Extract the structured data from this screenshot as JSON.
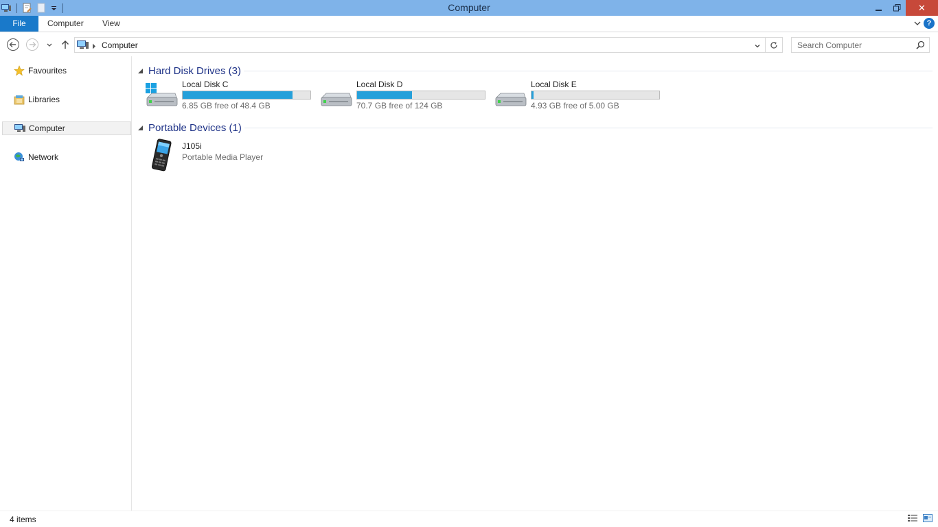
{
  "window": {
    "title": "Computer",
    "controls": {
      "minimize": "─",
      "maximize": "❐",
      "close": "✕"
    }
  },
  "ribbon": {
    "tabs": [
      {
        "label": "File"
      },
      {
        "label": "Computer"
      },
      {
        "label": "View"
      }
    ],
    "help": "?"
  },
  "address": {
    "crumb": "Computer",
    "search_placeholder": "Search Computer"
  },
  "nav": {
    "items": [
      {
        "label": "Favourites",
        "icon": "star-icon"
      },
      {
        "label": "Libraries",
        "icon": "libraries-icon"
      },
      {
        "label": "Computer",
        "icon": "computer-icon",
        "selected": true
      },
      {
        "label": "Network",
        "icon": "network-icon"
      }
    ]
  },
  "groups": {
    "hard_disk": {
      "title": "Hard Disk Drives (3)",
      "drives": [
        {
          "name": "Local Disk C",
          "free_text": "6.85 GB free of 48.4 GB",
          "used_fraction": 0.858,
          "system": true
        },
        {
          "name": "Local Disk D",
          "free_text": "70.7 GB free of 124 GB",
          "used_fraction": 0.43,
          "system": false
        },
        {
          "name": "Local Disk E",
          "free_text": "4.93 GB free of 5.00 GB",
          "used_fraction": 0.014,
          "system": false
        }
      ]
    },
    "portable": {
      "title": "Portable Devices (1)",
      "devices": [
        {
          "name": "J105i",
          "type": "Portable Media Player"
        }
      ]
    }
  },
  "status": {
    "count": "4 items"
  },
  "colors": {
    "titlebar": "#7fb3e9",
    "file_tab": "#1979ca",
    "close_button": "#c7493a",
    "usage_fill": "#26a0da",
    "group_title": "#1e3287"
  }
}
